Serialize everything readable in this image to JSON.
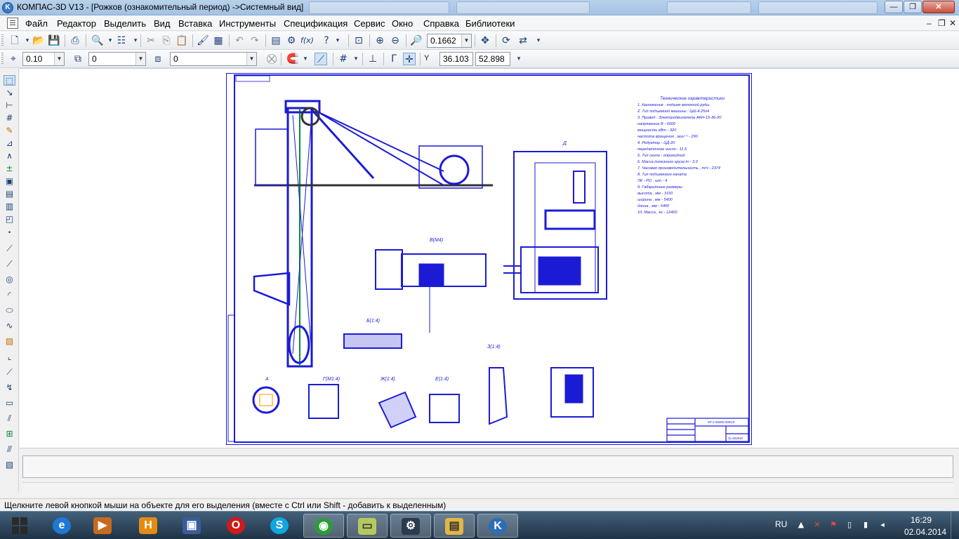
{
  "window": {
    "title": "КОМПАС-3D V13 - [Рожков (ознакомительный период) ->Системный вид]",
    "app_icon": "kompas-icon",
    "controls": {
      "minimize": "—",
      "restore": "❐",
      "close": "✕"
    }
  },
  "menu": {
    "items": [
      "Файл",
      "Редактор",
      "Выделить",
      "Вид",
      "Вставка",
      "Инструменты",
      "Спецификация",
      "Сервис",
      "Окно",
      "Справка",
      "Библиотеки"
    ],
    "mdi_controls": {
      "minimize": "–",
      "restore": "❐",
      "close": "✕"
    }
  },
  "toolbar_standard": {
    "zoom_value": "0.1662",
    "icons": [
      "new-document-icon",
      "open-icon",
      "save-icon",
      "print-icon",
      "print-preview-icon",
      "properties-icon",
      "cut-icon",
      "copy-icon",
      "paste-icon",
      "format-painter-icon",
      "table-icon",
      "undo-icon",
      "redo-icon",
      "manager-icon",
      "tree-icon",
      "formula-icon",
      "help-icon",
      "zoom-window-icon",
      "zoom-in-icon",
      "zoom-out-icon",
      "zoom-scale-icon",
      "pan-icon",
      "refresh-icon",
      "redraw-icon"
    ]
  },
  "toolbar_current_state": {
    "step": "0.10",
    "view": "0",
    "layer": "0",
    "coord_label": "Y",
    "x_coord": "36.103",
    "y_coord": "52.898"
  },
  "left_panel": {
    "icons": [
      "select-icon",
      "geometry-icon",
      "dimensions-icon",
      "designations-icon",
      "edit-icon",
      "parametrization-icon",
      "measure-icon",
      "selection-icon",
      "associative-views-icon",
      "spec-icon",
      "reports-icon",
      "insert-icon",
      "fragment-library-icon",
      "point-icon",
      "segment-icon",
      "polyline-icon",
      "circle-icon",
      "arc-icon",
      "ellipse-icon",
      "spline-icon",
      "hatch-icon",
      "chamfer-icon",
      "offset-icon",
      "collect-contour-icon",
      "rectangle-icon",
      "equidistant-icon",
      "macro-icon",
      "axis-icon",
      "text-icon"
    ]
  },
  "drawing": {
    "tech_title": "Технические характеристики",
    "tech_lines": [
      "1. Назначение : подъем молочной руды",
      "2. Тип подъемной машины : ЦШ-4.25х4",
      "3. Привод : Электродвигатель АКН-15-36-20",
      "   напряжение В - 6000",
      "   мощность кВт - 320",
      "   частота вращения , мин⁻¹ - 290",
      "4. Редуктор - ЦД-20",
      "   передаточное число - 11.5",
      "5. Тип скипа - опрокидной",
      "6. Масса полезного груза т - 3.0",
      "7. Часовая производительность , т/ч - 2374",
      "8. Тип подъемного каната",
      "   ЛК - РО , шт - 4",
      "9. Габаритные размеры",
      "   высота , мм - 3150",
      "   ширина , мм - 5400",
      "   длина , мм - 6400",
      "10. Масса , кг - 12400"
    ],
    "view_labels": [
      "Д",
      "В(М4)",
      "Б(1:4)",
      "З(1:4)",
      "А",
      "Г(М1:4)",
      "Ж(1:4)",
      "Е(1:4)"
    ],
    "stamp_code": "КР-2.00000.000СБ",
    "stamp_field": "Гр.402830",
    "sheet_code": "КР-2.00000.000СБ"
  },
  "status": {
    "hint": "Щелкните левой кнопкой мыши на объекте для его выделения (вместе с Ctrl или Shift - добавить к выделенным)"
  },
  "taskbar": {
    "apps": [
      {
        "name": "ie",
        "icon": "internet-explorer-icon",
        "glyph": "e",
        "color": "#1e79d6"
      },
      {
        "name": "media",
        "icon": "media-player-icon",
        "glyph": "▶",
        "color": "#c86a1c"
      },
      {
        "name": "h",
        "icon": "h-app-icon",
        "glyph": "H",
        "color": "#e38b12"
      },
      {
        "name": "save",
        "icon": "floppy-icon",
        "glyph": "▣",
        "color": "#3a5c9a"
      },
      {
        "name": "opera",
        "icon": "opera-icon",
        "glyph": "O",
        "color": "#d01a1a"
      },
      {
        "name": "skype",
        "icon": "skype-icon",
        "glyph": "S",
        "color": "#12a5e3"
      },
      {
        "name": "chrome",
        "icon": "chrome-icon",
        "glyph": "◉",
        "color": "#2d9b3b"
      },
      {
        "name": "notes",
        "icon": "notes-icon",
        "glyph": "▭",
        "color": "#b4c95e"
      },
      {
        "name": "steam",
        "icon": "steam-icon",
        "glyph": "⚙",
        "color": "#2a3b4f"
      },
      {
        "name": "explorer",
        "icon": "folder-icon",
        "glyph": "▤",
        "color": "#e0b646"
      },
      {
        "name": "kompas",
        "icon": "kompas-icon",
        "glyph": "K",
        "color": "#2e6db5"
      }
    ],
    "lang": "RU",
    "time": "16:29",
    "date": "02.04.2014"
  },
  "colors": {
    "drawing_blue": "#1b1bd6",
    "drawing_green": "#0a8a3a",
    "highlight_orange": "#ff8c00",
    "workspace_bg": "#ffffff"
  }
}
